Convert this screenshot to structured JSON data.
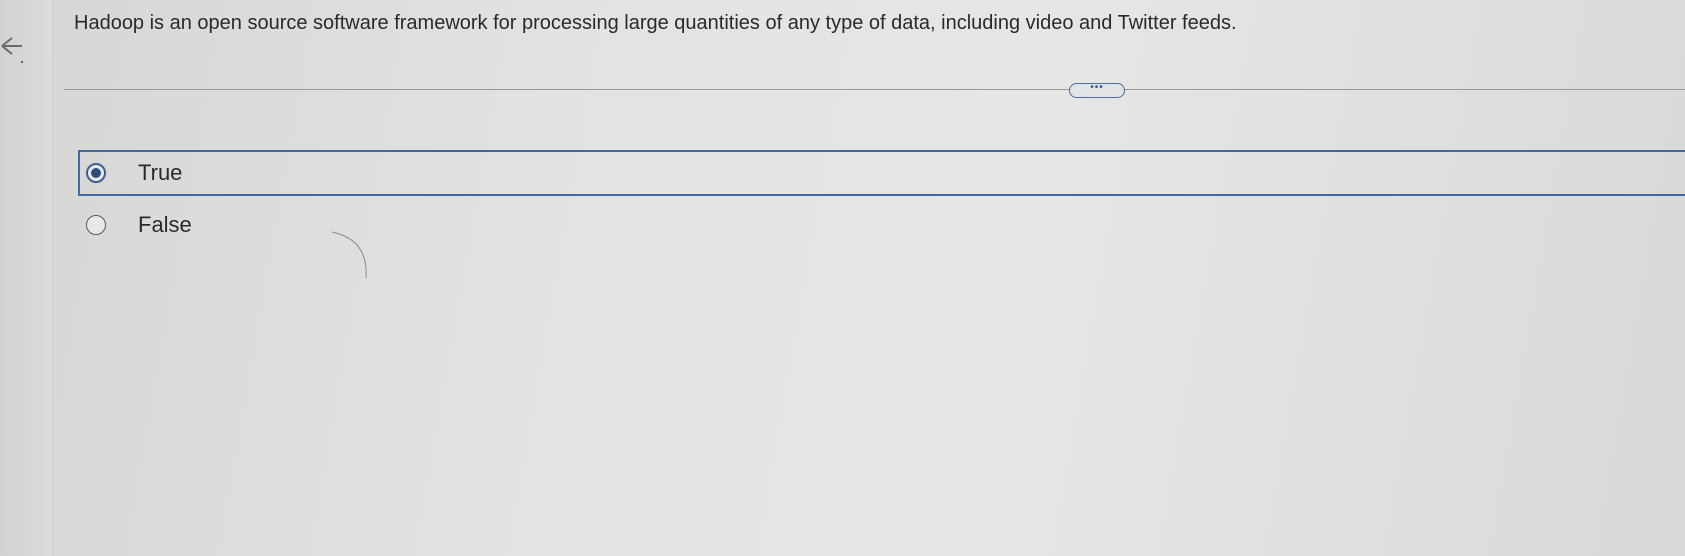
{
  "question": {
    "text": "Hadoop is an open source software framework for processing large quantities of any type of data, including video and Twitter feeds."
  },
  "more_button": {
    "label": "•••"
  },
  "options": [
    {
      "label": "True",
      "selected": true
    },
    {
      "label": "False",
      "selected": false
    }
  ],
  "icons": {
    "back": "arrow-left-icon",
    "radio_selected": "radio-selected-icon",
    "radio_unselected": "radio-unselected-icon"
  },
  "colors": {
    "accent": "#3f6aa0",
    "text": "#2a2a2a"
  }
}
